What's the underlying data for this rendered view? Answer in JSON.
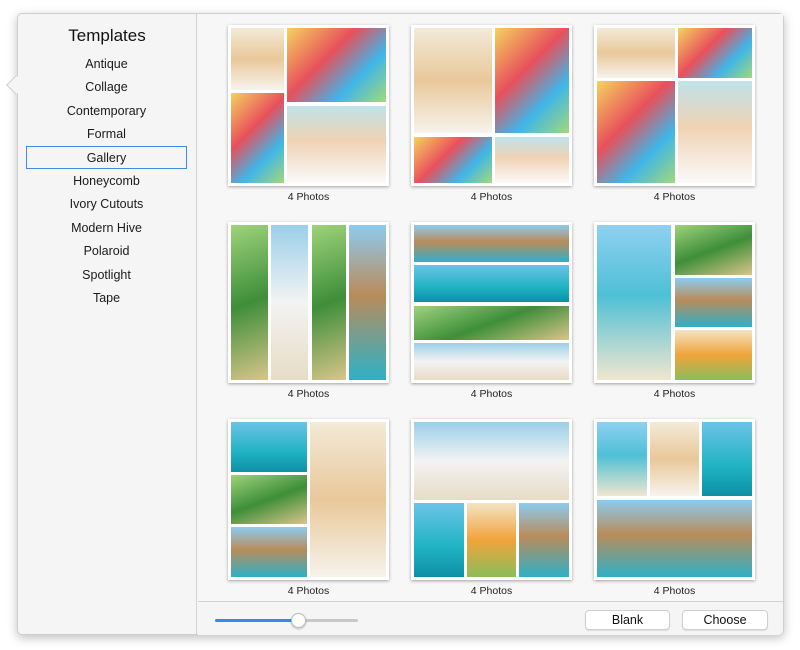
{
  "sidebar": {
    "title": "Templates",
    "selected": "Gallery",
    "items": [
      "Antique",
      "Collage",
      "Contemporary",
      "Formal",
      "Gallery",
      "Honeycomb",
      "Ivory Cutouts",
      "Modern Hive",
      "Polaroid",
      "Spotlight",
      "Tape"
    ]
  },
  "templates": [
    {
      "label": "4 Photos"
    },
    {
      "label": "4 Photos"
    },
    {
      "label": "4 Photos"
    },
    {
      "label": "4 Photos"
    },
    {
      "label": "4 Photos"
    },
    {
      "label": "4 Photos"
    },
    {
      "label": "4 Photos"
    },
    {
      "label": "4 Photos"
    },
    {
      "label": "4 Photos"
    }
  ],
  "zoom_slider": {
    "value_percent": 58
  },
  "buttons": {
    "blank": "Blank",
    "choose": "Choose"
  },
  "colors": {
    "accent": "#2f8cf0",
    "selection_border": "#3d8ee0"
  }
}
